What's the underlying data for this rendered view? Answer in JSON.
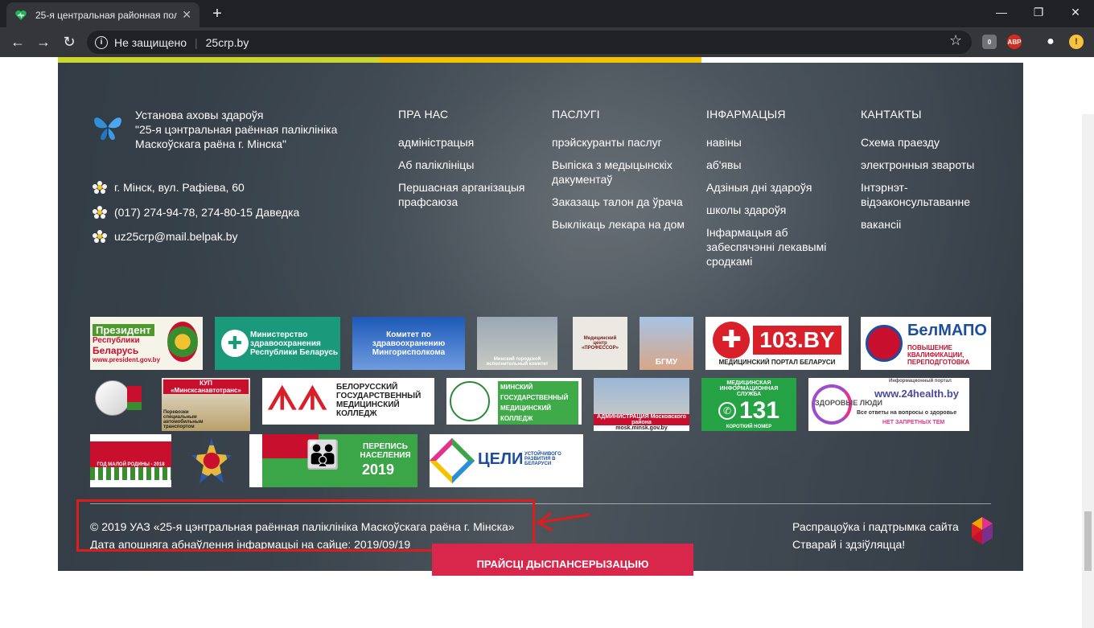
{
  "browser": {
    "tab_title": "25-я центральная районная пол",
    "url_security": "Не защищено",
    "url": "25crp.by",
    "ext_badge": "0",
    "ext_abp": "ABP"
  },
  "footer": {
    "org_lines": [
      "Установа аховы здароўя",
      "\"25-я цэнтральная раённая паліклініка",
      "Маскоўскага раёна г. Мінска\""
    ],
    "contacts": [
      {
        "icon": "flower-icon",
        "text": "г. Мінск, вул. Рафіева, 60"
      },
      {
        "icon": "flower-icon",
        "text": "(017) 274-94-78, 274-80-15 Даведка"
      },
      {
        "icon": "flower-icon",
        "text": "uz25crp@mail.belpak.by"
      }
    ],
    "columns": [
      {
        "heading": "ПРА НАС",
        "items": [
          "адміністрацыя",
          "Аб паліклініцы",
          "Першасная арганізацыя прафсаюза"
        ]
      },
      {
        "heading": "ПАСЛУГІ",
        "items": [
          "прэйскуранты паслуг",
          "Выпіска з медыцынскіх дакументаў",
          "Заказаць талон да ўрача",
          "Выклікаць лекара на дом"
        ]
      },
      {
        "heading": "ІНФАРМАЦЫЯ",
        "items": [
          "навіны",
          "аб'явы",
          "Адзіныя дні здароўя",
          "школы здароўя",
          "Інфармацыя аб забеспячэнні лекавымі сродкамі"
        ]
      },
      {
        "heading": "КАНТАКТЫ",
        "items": [
          "Схема праезду",
          "электронныя звароты",
          "Інтэрнэт-відэаконсультаванне",
          "вакансіі"
        ]
      }
    ],
    "logos": {
      "president_1": "Президент",
      "president_2": "Республики",
      "president_3": "Беларусь",
      "president_url": "www.president.gov.by",
      "minzdrav": "Министерство здравоохранения Республики Беларусь",
      "komitet": "Комитет по здравоохранению Мингорисполкома",
      "mgik": "Минский городской исполнительный комитет",
      "profossor": "Медицинский центр «ПРОФЕССОР»",
      "bgmu": "БГМУ",
      "portal103_main": "103.BY",
      "portal103_sub": "МЕДИЦИНСКИЙ ПОРТАЛ БЕЛАРУСИ",
      "belmapo_main": "БелМАПО",
      "belmapo_sub": "ПОВЫШЕНИЕ КВАЛИФИКАЦИИ, ПЕРЕПОДГОТОВКА",
      "kup": "КУП «Минсксанавтотранс»",
      "kup_sub": "Перевозки специальным автомобильным транспортом",
      "bgmk": "БЕЛОРУССКИЙ ГОСУДАРСТВЕННЫЙ МЕДИЦИНСКИЙ КОЛЛЕДЖ",
      "mgmk": "МИНСКИЙ ГОСУДАРСТВЕННЫЙ МЕДИЦИНСКИЙ КОЛЛЕДЖ",
      "admin_moskovsk": "АДМИНИСТРАЦИЯ Московского района",
      "admin_url": "mosk.minsk.gov.by",
      "s131_title": "МЕДИЦИНСКАЯ ИНФОРМАЦИОННАЯ СЛУЖБА",
      "s131_num": "131",
      "s131_sub": "КОРОТКИЙ НОМЕР",
      "h24_top": "Информационный портал",
      "h24_a": "ЗДОРОВЫЕ ЛЮДИ",
      "h24_b": "www.24health.by",
      "h24_c": "Все ответы на вопросы о здоровье",
      "h24_d": "НЕТ ЗАПРЕТНЫХ ТЕМ",
      "god": "ГОД МАЛОЙ РОДИНЫ - 2018",
      "perepis_1": "ПЕРЕПИСЬ НАСЕЛЕНИЯ",
      "perepis_2": "2019",
      "celi_1": "ЦЕЛИ",
      "celi_2": "УСТОЙЧИВОГО РАЗВИТИЯ В БЕЛАРУСИ"
    },
    "copyright": "© 2019 УАЗ «25-я цэнтральная раённая паліклініка Маскоўскага раёна г. Мінска»",
    "updated": "Дата апошняга абнаўлення інфармацыі на сайце: 2019/09/19",
    "dev_line1": "Распрацоўка і падтрымка сайта",
    "dev_line2": "Стварай і здзіўляцца!",
    "cta": "ПРАЙСЦІ ДЫСПАНСЕРЫЗАЦЫЮ"
  },
  "colors": {
    "accent_green": "#c8d62e",
    "accent_yellow": "#f3c300",
    "cta": "#d9274b",
    "annotation": "#e01b1b"
  }
}
